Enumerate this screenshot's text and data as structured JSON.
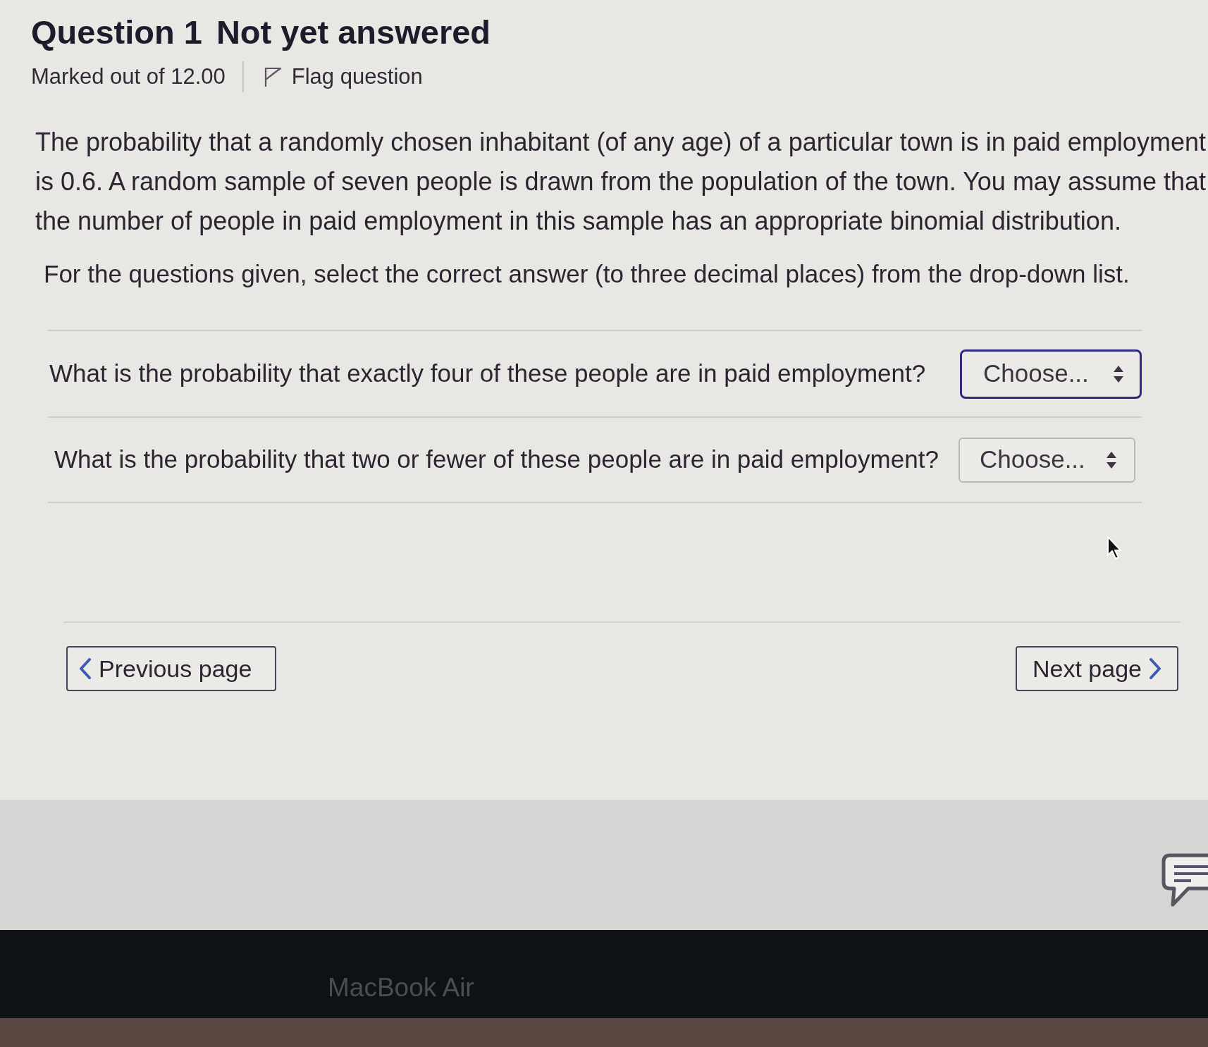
{
  "question": {
    "number": "Question 1",
    "status": "Not yet answered",
    "marks": "Marked out of 12.00",
    "flag_label": "Flag question"
  },
  "body": {
    "paragraph": "The probability that a randomly chosen inhabitant (of any age) of a particular town is in paid employment is 0.6. A random sample of seven people is drawn from the population of the town. You may assume that the number of people in paid employment in this sample has an appropriate binomial distribution.",
    "instruction": "For the questions given, select the correct answer (to three decimal places) from the drop-down list."
  },
  "subquestions": [
    {
      "prompt": "What is the probability that exactly four of these people are in paid employment?",
      "dropdown": {
        "value": "Choose...",
        "focused": true
      }
    },
    {
      "prompt": "What is the probability that two or fewer of these people are in paid employment?",
      "dropdown": {
        "value": "Choose...",
        "focused": false
      }
    }
  ],
  "navigation": {
    "previous": "Previous page",
    "next": "Next page"
  },
  "laptop": {
    "bezel_label": "MacBook Air"
  }
}
